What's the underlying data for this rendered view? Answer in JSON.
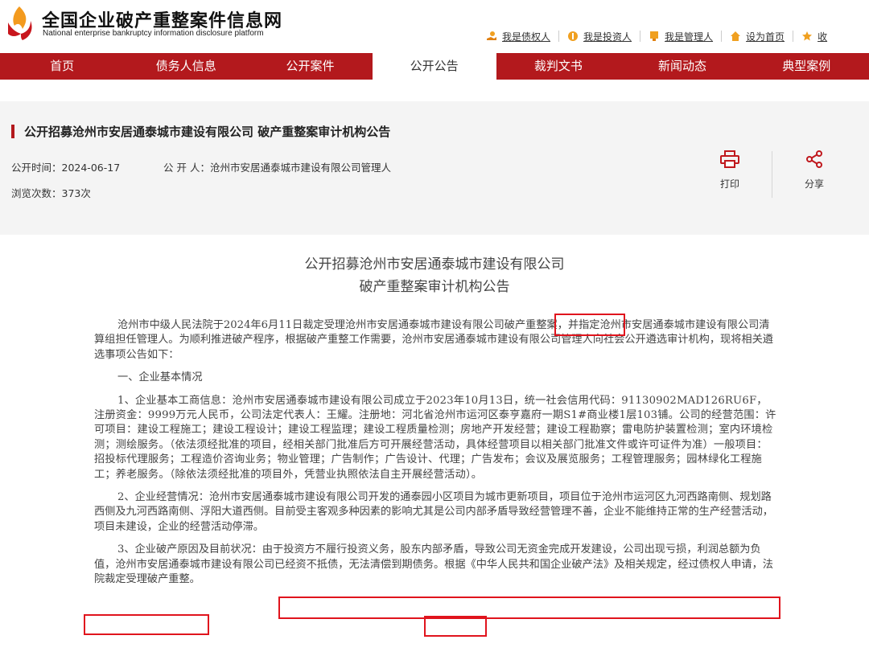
{
  "site": {
    "title": "全国企业破产重整案件信息网",
    "subtitle": "National enterprise bankruptcy information disclosure platform"
  },
  "top_links": [
    {
      "label": "我是债权人",
      "icon": "creditor-icon"
    },
    {
      "label": "我是投资人",
      "icon": "investor-icon"
    },
    {
      "label": "我是管理人",
      "icon": "manager-icon"
    },
    {
      "label": "设为首页",
      "icon": "home-icon"
    },
    {
      "label": "收",
      "icon": "star-icon"
    }
  ],
  "nav": {
    "items": [
      "首页",
      "债务人信息",
      "公开案件",
      "公开公告",
      "裁判文书",
      "新闻动态",
      "典型案例"
    ],
    "active_index": 3
  },
  "article": {
    "title": "公开招募沧州市安居通泰城市建设有限公司 破产重整案审计机构公告",
    "publish_time": "公开时间：2024-06-17",
    "publisher": "公 开 人：沧州市安居通泰城市建设有限公司管理人",
    "views": "浏览次数：373次",
    "print_label": "打印",
    "share_label": "分享"
  },
  "document": {
    "title_line1": "公开招募沧州市安居通泰城市建设有限公司",
    "title_line2": "破产重整案审计机构公告",
    "para1": "沧州市中级人民法院于2024年6月11日裁定受理沧州市安居通泰城市建设有限公司破产重整案，并指定沧州市安居通泰城市建设有限公司清算组担任管理人。为顺利推进破产程序，根据破产重整工作需要，沧州市安居通泰城市建设有限公司管理人向社会公开遴选审计机构，现将相关遴选事项公告如下：",
    "section1": "一、企业基本情况",
    "para2": "1、企业基本工商信息：沧州市安居通泰城市建设有限公司成立于2023年10月13日，统一社会信用代码：91130902MAD126RU6F，注册资金：9999万元人民币，公司法定代表人：王耀。注册地：河北省沧州市运河区泰亨嘉府一期S1#商业楼1层103铺。公司的经营范围：许可项目：建设工程施工；建设工程设计；建设工程监理；建设工程质量检测；房地产开发经营；建设工程勘察；雷电防护装置检测；室内环境检测；测绘服务。（依法须经批准的项目，经相关部门批准后方可开展经营活动，具体经营项目以相关部门批准文件或许可证件为准）一般项目：招投标代理服务；工程造价咨询业务；物业管理；广告制作；广告设计、代理；广告发布；会议及展览服务；工程管理服务；园林绿化工程施工；养老服务。（除依法须经批准的项目外，凭营业执照依法自主开展经营活动）。",
    "para3": "2、企业经营情况：沧州市安居通泰城市建设有限公司开发的通泰园小区项目为城市更新项目，项目位于沧州市运河区九河西路南侧、规划路西侧及九河西路南侧、浮阳大道西侧。目前受主客观多种因素的影响尤其是公司内部矛盾导致经营管理不善，企业不能维持正常的生产经营活动，项目未建设，企业的经营活动停滞。",
    "para4": "3、企业破产原因及目前状况：由于投资方不履行投资义务，股东内部矛盾，导致公司无资金完成开发建设，公司出现亏损，利润总额为负值，沧州市安居通泰城市建设有限公司已经资不抵债，无法清偿到期债务。根据《中华人民共和国企业破产法》及相关规定，经过债权人申请，法院裁定受理破产重整。"
  },
  "colors": {
    "brand_red": "#b3191d",
    "highlight_red": "#e0141d",
    "info_bg": "#f4f4f4"
  }
}
